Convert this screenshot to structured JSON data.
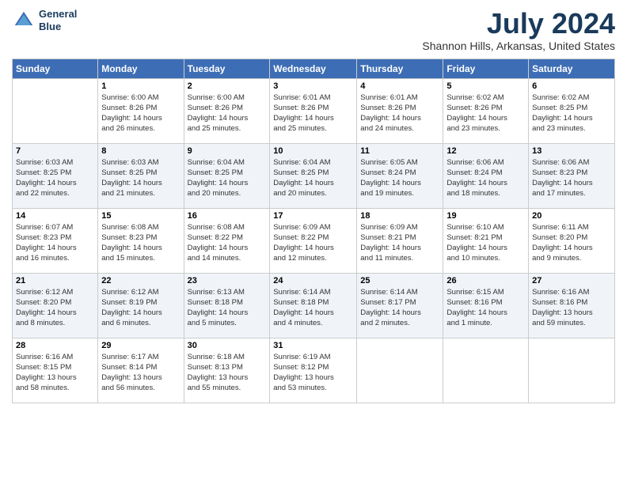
{
  "logo": {
    "line1": "General",
    "line2": "Blue"
  },
  "title": "July 2024",
  "location": "Shannon Hills, Arkansas, United States",
  "days_of_week": [
    "Sunday",
    "Monday",
    "Tuesday",
    "Wednesday",
    "Thursday",
    "Friday",
    "Saturday"
  ],
  "weeks": [
    [
      {
        "day": "",
        "info": ""
      },
      {
        "day": "1",
        "info": "Sunrise: 6:00 AM\nSunset: 8:26 PM\nDaylight: 14 hours\nand 26 minutes."
      },
      {
        "day": "2",
        "info": "Sunrise: 6:00 AM\nSunset: 8:26 PM\nDaylight: 14 hours\nand 25 minutes."
      },
      {
        "day": "3",
        "info": "Sunrise: 6:01 AM\nSunset: 8:26 PM\nDaylight: 14 hours\nand 25 minutes."
      },
      {
        "day": "4",
        "info": "Sunrise: 6:01 AM\nSunset: 8:26 PM\nDaylight: 14 hours\nand 24 minutes."
      },
      {
        "day": "5",
        "info": "Sunrise: 6:02 AM\nSunset: 8:26 PM\nDaylight: 14 hours\nand 23 minutes."
      },
      {
        "day": "6",
        "info": "Sunrise: 6:02 AM\nSunset: 8:25 PM\nDaylight: 14 hours\nand 23 minutes."
      }
    ],
    [
      {
        "day": "7",
        "info": "Sunrise: 6:03 AM\nSunset: 8:25 PM\nDaylight: 14 hours\nand 22 minutes."
      },
      {
        "day": "8",
        "info": "Sunrise: 6:03 AM\nSunset: 8:25 PM\nDaylight: 14 hours\nand 21 minutes."
      },
      {
        "day": "9",
        "info": "Sunrise: 6:04 AM\nSunset: 8:25 PM\nDaylight: 14 hours\nand 20 minutes."
      },
      {
        "day": "10",
        "info": "Sunrise: 6:04 AM\nSunset: 8:25 PM\nDaylight: 14 hours\nand 20 minutes."
      },
      {
        "day": "11",
        "info": "Sunrise: 6:05 AM\nSunset: 8:24 PM\nDaylight: 14 hours\nand 19 minutes."
      },
      {
        "day": "12",
        "info": "Sunrise: 6:06 AM\nSunset: 8:24 PM\nDaylight: 14 hours\nand 18 minutes."
      },
      {
        "day": "13",
        "info": "Sunrise: 6:06 AM\nSunset: 8:23 PM\nDaylight: 14 hours\nand 17 minutes."
      }
    ],
    [
      {
        "day": "14",
        "info": "Sunrise: 6:07 AM\nSunset: 8:23 PM\nDaylight: 14 hours\nand 16 minutes."
      },
      {
        "day": "15",
        "info": "Sunrise: 6:08 AM\nSunset: 8:23 PM\nDaylight: 14 hours\nand 15 minutes."
      },
      {
        "day": "16",
        "info": "Sunrise: 6:08 AM\nSunset: 8:22 PM\nDaylight: 14 hours\nand 14 minutes."
      },
      {
        "day": "17",
        "info": "Sunrise: 6:09 AM\nSunset: 8:22 PM\nDaylight: 14 hours\nand 12 minutes."
      },
      {
        "day": "18",
        "info": "Sunrise: 6:09 AM\nSunset: 8:21 PM\nDaylight: 14 hours\nand 11 minutes."
      },
      {
        "day": "19",
        "info": "Sunrise: 6:10 AM\nSunset: 8:21 PM\nDaylight: 14 hours\nand 10 minutes."
      },
      {
        "day": "20",
        "info": "Sunrise: 6:11 AM\nSunset: 8:20 PM\nDaylight: 14 hours\nand 9 minutes."
      }
    ],
    [
      {
        "day": "21",
        "info": "Sunrise: 6:12 AM\nSunset: 8:20 PM\nDaylight: 14 hours\nand 8 minutes."
      },
      {
        "day": "22",
        "info": "Sunrise: 6:12 AM\nSunset: 8:19 PM\nDaylight: 14 hours\nand 6 minutes."
      },
      {
        "day": "23",
        "info": "Sunrise: 6:13 AM\nSunset: 8:18 PM\nDaylight: 14 hours\nand 5 minutes."
      },
      {
        "day": "24",
        "info": "Sunrise: 6:14 AM\nSunset: 8:18 PM\nDaylight: 14 hours\nand 4 minutes."
      },
      {
        "day": "25",
        "info": "Sunrise: 6:14 AM\nSunset: 8:17 PM\nDaylight: 14 hours\nand 2 minutes."
      },
      {
        "day": "26",
        "info": "Sunrise: 6:15 AM\nSunset: 8:16 PM\nDaylight: 14 hours\nand 1 minute."
      },
      {
        "day": "27",
        "info": "Sunrise: 6:16 AM\nSunset: 8:16 PM\nDaylight: 13 hours\nand 59 minutes."
      }
    ],
    [
      {
        "day": "28",
        "info": "Sunrise: 6:16 AM\nSunset: 8:15 PM\nDaylight: 13 hours\nand 58 minutes."
      },
      {
        "day": "29",
        "info": "Sunrise: 6:17 AM\nSunset: 8:14 PM\nDaylight: 13 hours\nand 56 minutes."
      },
      {
        "day": "30",
        "info": "Sunrise: 6:18 AM\nSunset: 8:13 PM\nDaylight: 13 hours\nand 55 minutes."
      },
      {
        "day": "31",
        "info": "Sunrise: 6:19 AM\nSunset: 8:12 PM\nDaylight: 13 hours\nand 53 minutes."
      },
      {
        "day": "",
        "info": ""
      },
      {
        "day": "",
        "info": ""
      },
      {
        "day": "",
        "info": ""
      }
    ]
  ]
}
